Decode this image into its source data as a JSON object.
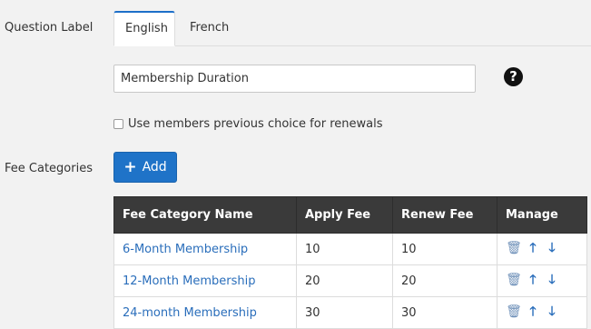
{
  "labels": {
    "question_label": "Question Label",
    "fee_categories": "Fee Categories"
  },
  "tabs": [
    {
      "label": "English",
      "active": true
    },
    {
      "label": "French",
      "active": false
    }
  ],
  "question": {
    "value": "Membership Duration",
    "help_icon": "question-circle-icon"
  },
  "renewal_checkbox": {
    "label": "Use members previous choice for renewals",
    "checked": false
  },
  "add_button": {
    "label": "Add",
    "icon": "plus-icon"
  },
  "table": {
    "headers": [
      "Fee Category Name",
      "Apply Fee",
      "Renew Fee",
      "Manage"
    ],
    "rows": [
      {
        "name": "6-Month Membership",
        "apply": "10",
        "renew": "10"
      },
      {
        "name": "12-Month Membership",
        "apply": "20",
        "renew": "20"
      },
      {
        "name": "24-month Membership",
        "apply": "30",
        "renew": "30"
      }
    ],
    "manage_icons": [
      "trash-icon",
      "arrow-up-icon",
      "arrow-down-icon"
    ]
  },
  "colors": {
    "accent": "#1f73c8",
    "link": "#2a6ebb",
    "table_header": "#3a3a3a"
  }
}
